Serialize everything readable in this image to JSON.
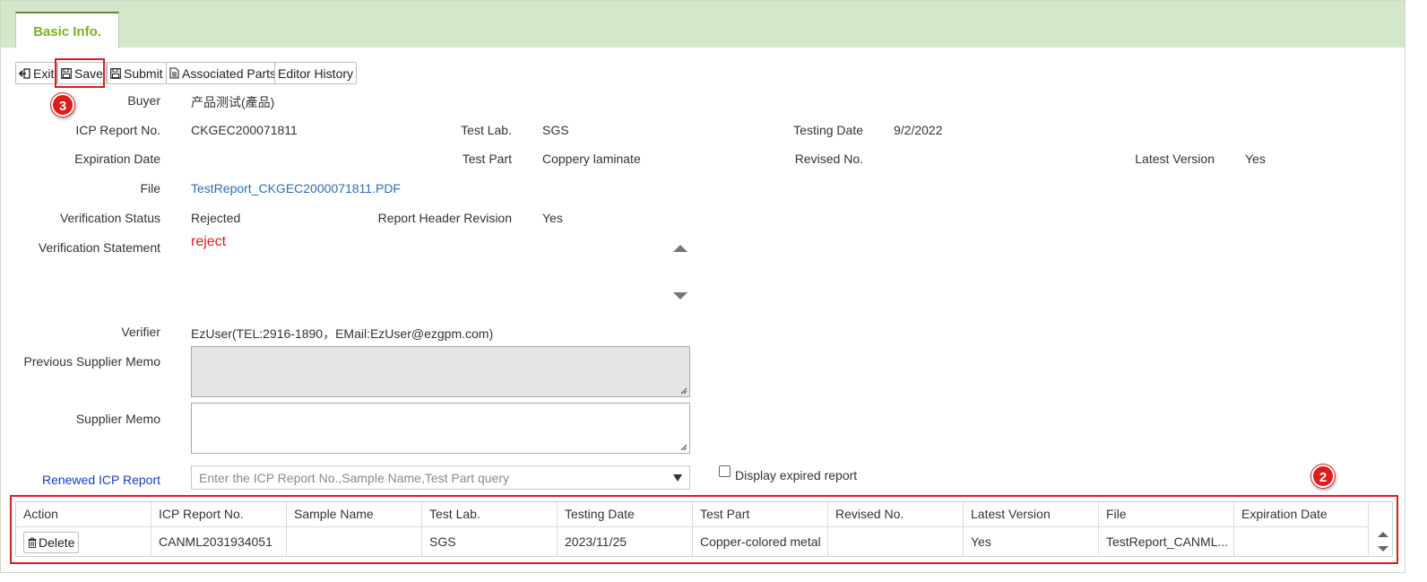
{
  "tabs": {
    "basic_info": "Basic Info."
  },
  "toolbar": {
    "exit": "Exit",
    "save": "Save",
    "submit": "Submit",
    "associated_parts": "Associated Parts",
    "editor_history": "Editor History"
  },
  "badges": {
    "save_step": "3",
    "grid_step": "2"
  },
  "form": {
    "buyer_label": "Buyer",
    "buyer_value": "产品测试(產品)",
    "icp_report_no_label": "ICP Report No.",
    "icp_report_no_value": "CKGEC200071811",
    "test_lab_label": "Test Lab.",
    "test_lab_value": "SGS",
    "testing_date_label": "Testing Date",
    "testing_date_value": "9/2/2022",
    "expiration_date_label": "Expiration Date",
    "expiration_date_value": "",
    "test_part_label": "Test Part",
    "test_part_value": "Coppery laminate",
    "revised_no_label": "Revised No.",
    "revised_no_value": "",
    "latest_version_label": "Latest Version",
    "latest_version_value": "Yes",
    "file_label": "File",
    "file_value": "TestReport_CKGEC2000071811.PDF",
    "verification_status_label": "Verification Status",
    "verification_status_value": "Rejected",
    "report_header_revision_label": "Report Header Revision",
    "report_header_revision_value": "Yes",
    "verification_statement_label": "Verification Statement",
    "verification_statement_value": "reject",
    "verifier_label": "Verifier",
    "verifier_value": "EzUser(TEL:2916-1890，EMail:EzUser@ezgpm.com)",
    "previous_supplier_memo_label": "Previous Supplier Memo",
    "supplier_memo_label": "Supplier Memo",
    "renewed_icp_report_label": "Renewed ICP Report",
    "renewed_icp_report_placeholder": "Enter the ICP Report No.,Sample Name,Test Part query",
    "display_expired_label": "Display expired report"
  },
  "grid": {
    "headers": [
      "Action",
      "ICP Report No.",
      "Sample Name",
      "Test Lab.",
      "Testing Date",
      "Test Part",
      "Revised No.",
      "Latest Version",
      "File",
      "Expiration Date"
    ],
    "rows": [
      {
        "action": "Delete",
        "icp_report_no": "CANML2031934051",
        "sample_name": "",
        "test_lab": "SGS",
        "testing_date": "2023/11/25",
        "test_part": "Copper-colored metal",
        "revised_no": "",
        "latest_version": "Yes",
        "file": "TestReport_CANML...",
        "expiration_date": ""
      }
    ]
  },
  "colors": {
    "tab_bar_bg": "#d4e8c9",
    "tab_text": "#7ab11f",
    "highlight_red": "#e01b1b",
    "link_blue": "#2a6fb6",
    "statement_red": "#e01b1b"
  }
}
